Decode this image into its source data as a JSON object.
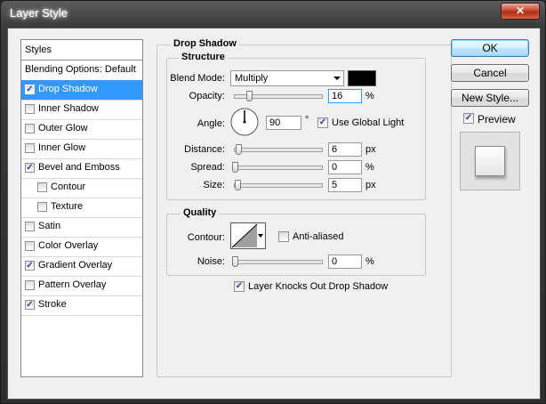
{
  "window": {
    "title": "Layer Style",
    "close_glyph": "✕"
  },
  "styles_list": {
    "header": "Styles",
    "blending": "Blending Options: Default",
    "items": [
      {
        "label": "Drop Shadow",
        "checked": true,
        "selected": true,
        "indent": false
      },
      {
        "label": "Inner Shadow",
        "checked": false,
        "selected": false,
        "indent": false
      },
      {
        "label": "Outer Glow",
        "checked": false,
        "selected": false,
        "indent": false
      },
      {
        "label": "Inner Glow",
        "checked": false,
        "selected": false,
        "indent": false
      },
      {
        "label": "Bevel and Emboss",
        "checked": true,
        "selected": false,
        "indent": false
      },
      {
        "label": "Contour",
        "checked": false,
        "selected": false,
        "indent": true
      },
      {
        "label": "Texture",
        "checked": false,
        "selected": false,
        "indent": true
      },
      {
        "label": "Satin",
        "checked": false,
        "selected": false,
        "indent": false
      },
      {
        "label": "Color Overlay",
        "checked": false,
        "selected": false,
        "indent": false
      },
      {
        "label": "Gradient Overlay",
        "checked": true,
        "selected": false,
        "indent": false
      },
      {
        "label": "Pattern Overlay",
        "checked": false,
        "selected": false,
        "indent": false
      },
      {
        "label": "Stroke",
        "checked": true,
        "selected": false,
        "indent": false
      }
    ]
  },
  "drop_shadow": {
    "title": "Drop Shadow",
    "structure": {
      "title": "Structure",
      "blend_mode_label": "Blend Mode:",
      "blend_mode_value": "Multiply",
      "shadow_color": "#000000",
      "opacity_label": "Opacity:",
      "opacity_value": "16",
      "opacity_fraction": 0.16,
      "opacity_unit": "%",
      "angle_label": "Angle:",
      "angle_value": "90",
      "angle_unit": "°",
      "use_global_light_label": "Use Global Light",
      "use_global_light_checked": true,
      "distance_label": "Distance:",
      "distance_value": "6",
      "distance_unit": "px",
      "spread_label": "Spread:",
      "spread_value": "0",
      "spread_unit": "%",
      "size_label": "Size:",
      "size_value": "5",
      "size_unit": "px"
    },
    "quality": {
      "title": "Quality",
      "contour_label": "Contour:",
      "anti_aliased_label": "Anti-aliased",
      "anti_aliased_checked": false,
      "noise_label": "Noise:",
      "noise_value": "0",
      "noise_unit": "%"
    },
    "knockout_label": "Layer Knocks Out Drop Shadow",
    "knockout_checked": true
  },
  "buttons": {
    "ok": "OK",
    "cancel": "Cancel",
    "new_style": "New Style..."
  },
  "preview": {
    "label": "Preview",
    "checked": true
  }
}
